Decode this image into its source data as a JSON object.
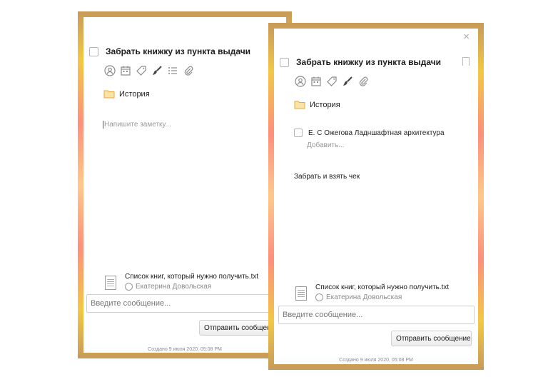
{
  "task": {
    "title": "Забрать книжку из пункта выдачи"
  },
  "icons": [
    "assignee-icon",
    "calendar-icon",
    "tag-icon",
    "brush-icon",
    "checklist-icon",
    "attachment-icon"
  ],
  "folder": {
    "name": "История",
    "icon": "folder-icon",
    "color": "#f2b233"
  },
  "left_card": {
    "note_placeholder": "Напишите заметку...",
    "message_placeholder": "Введите сообщение...",
    "send_label": "Отправить сообщение",
    "created": "Создано 9 июля 2020, 05:08 PM"
  },
  "right_card": {
    "subtask": "Е. С Ожегова Ладншафтная архитектура",
    "add_placeholder": "Добавить...",
    "note": "Забрать и взять чек",
    "message_placeholder": "Введите сообщение...",
    "send_label": "Отправить сообщение",
    "created": "Создано 9 июля 2020, 05:08 PM"
  },
  "attachment": {
    "file_name": "Список книг, который нужно получить.txt",
    "author": "Екатерина Довольская"
  },
  "colors": {
    "border_gold": "#c79a58",
    "border_yellow": "#f2c845",
    "border_coral": "#ff8f7a",
    "folder": "#f2b233"
  }
}
